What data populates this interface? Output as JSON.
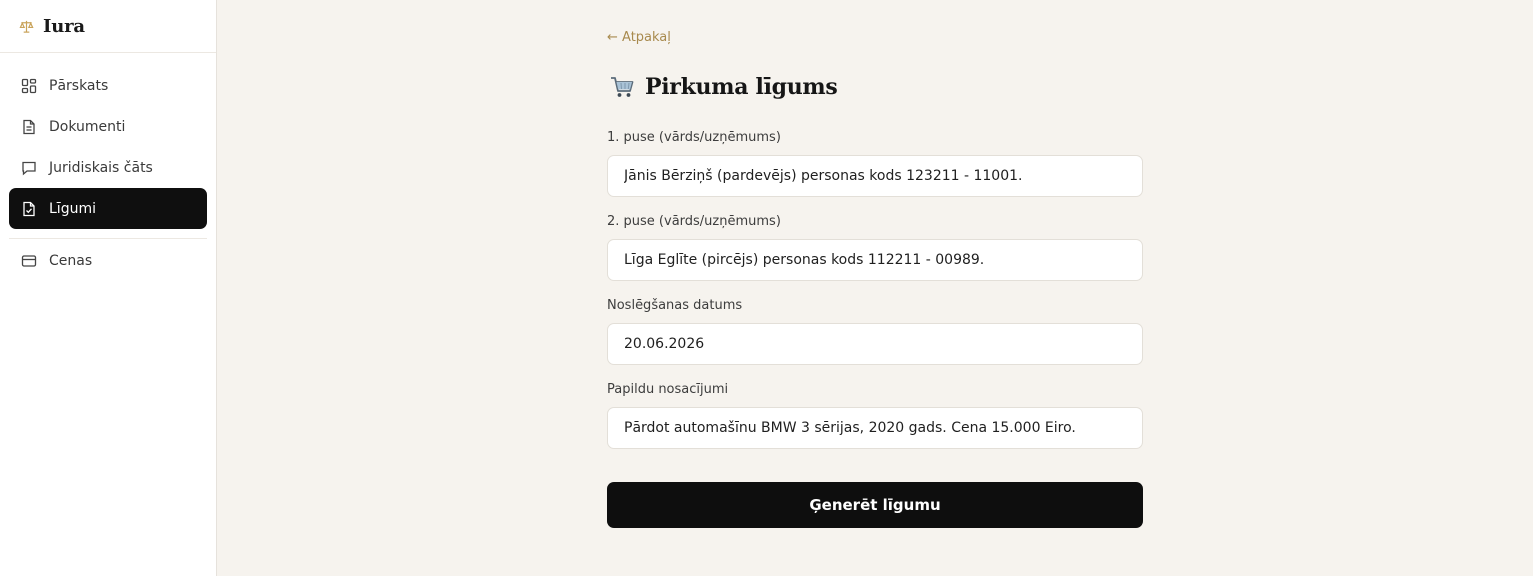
{
  "brand": {
    "name": "Iura",
    "icon": "scales-icon",
    "accent": "#c9a35a"
  },
  "sidebar": {
    "items": [
      {
        "label": "Pārskats",
        "icon": "grid-icon"
      },
      {
        "label": "Dokumenti",
        "icon": "document-icon"
      },
      {
        "label": "Juridiskais čāts",
        "icon": "chat-icon"
      },
      {
        "label": "Līgumi",
        "icon": "contract-icon",
        "active": true
      },
      {
        "label": "Cenas",
        "icon": "card-icon"
      }
    ]
  },
  "main": {
    "back_label": "← Atpakaļ",
    "title": "Pirkuma līgums",
    "title_icon": "cart-icon",
    "fields": [
      {
        "label": "1. puse (vārds/uzņēmums)",
        "value": "Jānis Bērziņš (pardevējs) personas kods 123211 - 11001."
      },
      {
        "label": "2. puse (vārds/uzņēmums)",
        "value": "Līga Eglīte (pircējs) personas kods 112211 - 00989."
      },
      {
        "label": "Noslēgšanas datums",
        "value": "20.06.2026"
      },
      {
        "label": "Papildu nosacījumi",
        "value": "Pārdot automašīnu BMW 3 sērijas, 2020 gads. Cena 15.000 Eiro."
      }
    ],
    "submit_label": "Ģenerēt līgumu"
  },
  "colors": {
    "background": "#f6f3ee",
    "active_nav": "#0f0f0f",
    "link": "#a88a4e"
  }
}
